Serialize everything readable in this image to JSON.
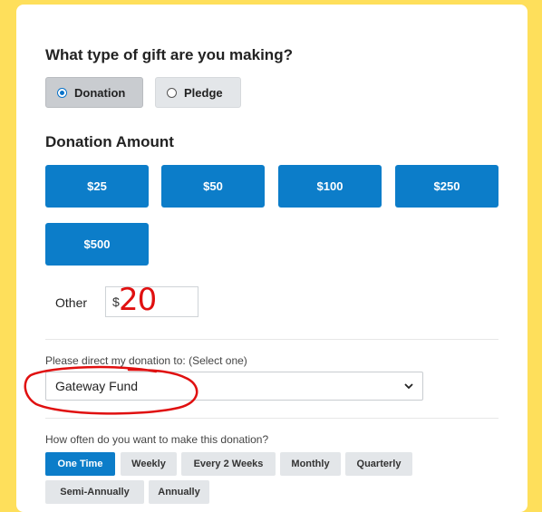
{
  "gift_type": {
    "question": "What type of gift are you making?",
    "options": [
      "Donation",
      "Pledge"
    ],
    "selected": "Donation"
  },
  "amount": {
    "heading": "Donation Amount",
    "buttons": [
      "$25",
      "$50",
      "$100",
      "$250",
      "$500"
    ],
    "other_label": "Other",
    "currency_symbol": "$",
    "other_value": "20"
  },
  "direct": {
    "label": "Please direct my donation to: (Select one)",
    "selected": "Gateway Fund"
  },
  "frequency": {
    "question": "How often do you want to make this donation?",
    "options": [
      "One Time",
      "Weekly",
      "Every 2 Weeks",
      "Monthly",
      "Quarterly",
      "Semi-Annually",
      "Annually"
    ],
    "selected": "One Time"
  },
  "colors": {
    "background": "#fedf5b",
    "accent": "#0c7dc9",
    "annotation": "#e01010"
  }
}
